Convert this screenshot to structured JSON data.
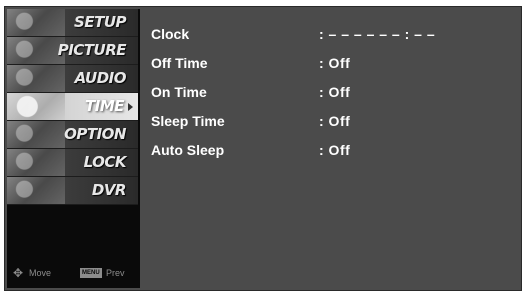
{
  "menu": {
    "items": [
      {
        "label": "SETUP"
      },
      {
        "label": "PICTURE"
      },
      {
        "label": "AUDIO"
      },
      {
        "label": "TIME"
      },
      {
        "label": "OPTION"
      },
      {
        "label": "LOCK"
      },
      {
        "label": "DVR"
      }
    ],
    "selected": "TIME"
  },
  "footer": {
    "move_icon": "move-arrows-icon",
    "move_label": "Move",
    "menu_key": "MENU",
    "prev_label": "Prev"
  },
  "time_settings": [
    {
      "name": "Clock",
      "value": ": – – – – – – : – –"
    },
    {
      "name": "Off Time",
      "value": ": Off"
    },
    {
      "name": "On Time",
      "value": ": Off"
    },
    {
      "name": "Sleep Time",
      "value": ": Off"
    },
    {
      "name": "Auto Sleep",
      "value": ": Off"
    }
  ]
}
